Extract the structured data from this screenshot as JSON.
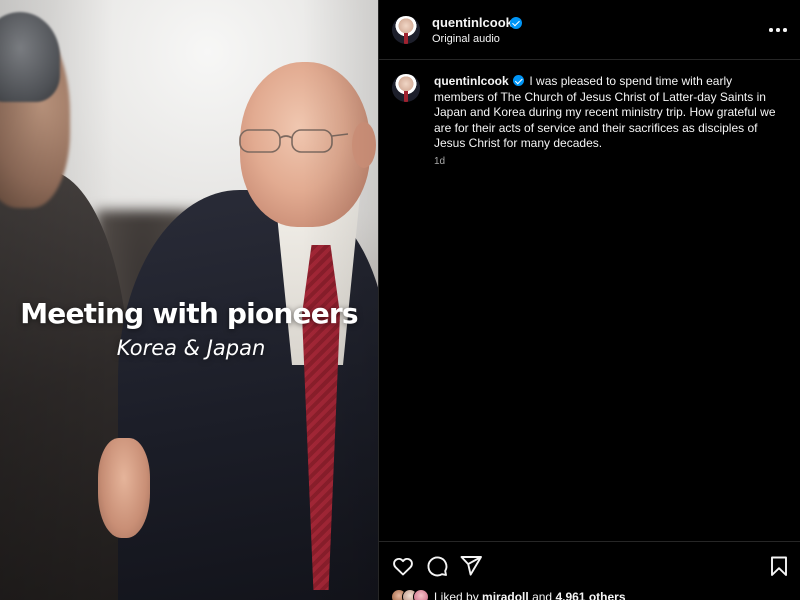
{
  "post": {
    "media": {
      "overlay_title": "Meeting with pioneers",
      "overlay_subtitle": "Korea & Japan"
    },
    "header": {
      "username": "quentinlcook",
      "audio": "Original audio",
      "more_icon": "more-horizontal-icon",
      "verified_icon": "verified-badge-icon"
    },
    "caption": {
      "username": "quentinlcook",
      "text": "I was pleased to spend time with early members of The Church of Jesus Christ of Latter-day Saints in Japan and Korea during my recent ministry trip. How grateful we are for their acts of service and their sacrifices as disciples of Jesus Christ for many decades.",
      "timestamp": "1d"
    },
    "actions": {
      "icons": [
        "heart-icon",
        "comment-icon",
        "share-icon",
        "bookmark-icon"
      ]
    },
    "likes": {
      "prefix": "Liked by",
      "user": "miradoll",
      "connector": "and",
      "others": "4,961 others"
    }
  },
  "colors": {
    "background": "#000000",
    "text": "#f5f5f5",
    "muted": "#a8a8a8",
    "verified": "#0095f6",
    "divider": "#262626"
  }
}
